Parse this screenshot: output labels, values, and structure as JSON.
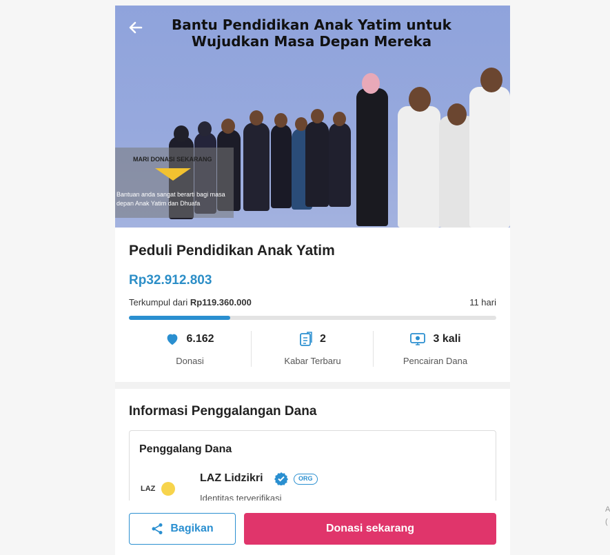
{
  "hero": {
    "title": "Bantu Pendidikan Anak Yatim untuk Wujudkan Masa Depan Mereka",
    "card_title": "MARI DONASI SEKARANG",
    "card_text": "Bantuan anda sangat berarti bagi masa depan Anak Yatim dan Dhuafa",
    "back_icon": "arrow-left-icon"
  },
  "campaign": {
    "title": "Peduli Pendidikan Anak Yatim",
    "raised": "Rp32.912.803",
    "target_prefix": "Terkumpul dari",
    "target_amount": "Rp119.360.000",
    "days_left": "11 hari",
    "progress_fraction": 0.276
  },
  "stats": [
    {
      "icon": "heart-icon",
      "value": "6.162",
      "label": "Donasi"
    },
    {
      "icon": "news-icon",
      "value": "2",
      "label": "Kabar Terbaru"
    },
    {
      "icon": "withdraw-icon",
      "value": "3 kali",
      "label": "Pencairan Dana"
    }
  ],
  "info": {
    "title": "Informasi Penggalangan Dana",
    "fundraiser_label": "Penggalang Dana",
    "org_logo_text": "LAZ",
    "org_name": "LAZ Lidzikri",
    "org_badge": "ORG",
    "org_status": "Identitas terverifikasi"
  },
  "actions": {
    "share_label": "Bagikan",
    "donate_label": "Donasi sekarang"
  },
  "edge": {
    "top": "A",
    "bottom": "("
  },
  "colors": {
    "accent_blue": "#2a8fd0",
    "donate_pink": "#e0356b",
    "raised_blue": "#2c8ec7"
  }
}
